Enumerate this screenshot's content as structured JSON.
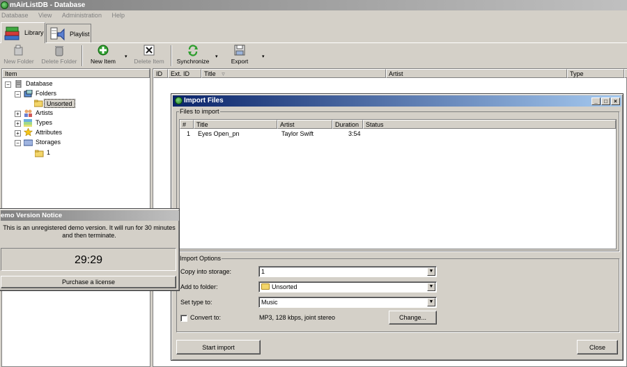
{
  "window": {
    "title": "mAirListDB - Database"
  },
  "menu": [
    "Database",
    "View",
    "Administration",
    "Help"
  ],
  "tabs": [
    {
      "label": "Library"
    },
    {
      "label": "Playlist"
    }
  ],
  "toolbar": {
    "new_folder": "New Folder",
    "delete_folder": "Delete Folder",
    "new_item": "New Item",
    "delete_item": "Delete Item",
    "synchronize": "Synchronize",
    "export": "Export"
  },
  "tree": {
    "header": "Item",
    "root": "Database",
    "folders": "Folders",
    "unsorted": "Unsorted",
    "artists": "Artists",
    "types": "Types",
    "attributes": "Attributes",
    "storages": "Storages",
    "storage_1": "1"
  },
  "grid_columns": [
    "ID",
    "Ext. ID",
    "Title",
    "Artist",
    "Type",
    "D"
  ],
  "import_dialog": {
    "title": "Import Files",
    "files_group": "Files to import",
    "columns": [
      "#",
      "Title",
      "Artist",
      "Duration",
      "Status"
    ],
    "rows": [
      {
        "num": "1",
        "title": "Eyes Open_pn",
        "artist": "Taylor Swift",
        "duration": "3:54",
        "status": ""
      }
    ],
    "options_group": "Import Options",
    "copy_into_storage_label": "Copy into storage:",
    "copy_into_storage_value": "1",
    "add_to_folder_label": "Add to folder:",
    "add_to_folder_value": "Unsorted",
    "set_type_label": "Set type to:",
    "set_type_value": "Music",
    "convert_label": "Convert to:",
    "convert_format": "MP3, 128 kbps, joint stereo",
    "convert_checked": false,
    "change_button": "Change...",
    "start_button": "Start import",
    "close_button": "Close"
  },
  "demo_notice": {
    "title": "emo Version Notice",
    "message": "This is an unregistered demo version. It will run for 30 minutes and then terminate.",
    "countdown": "29:29",
    "purchase_button": "Purchase a license"
  }
}
